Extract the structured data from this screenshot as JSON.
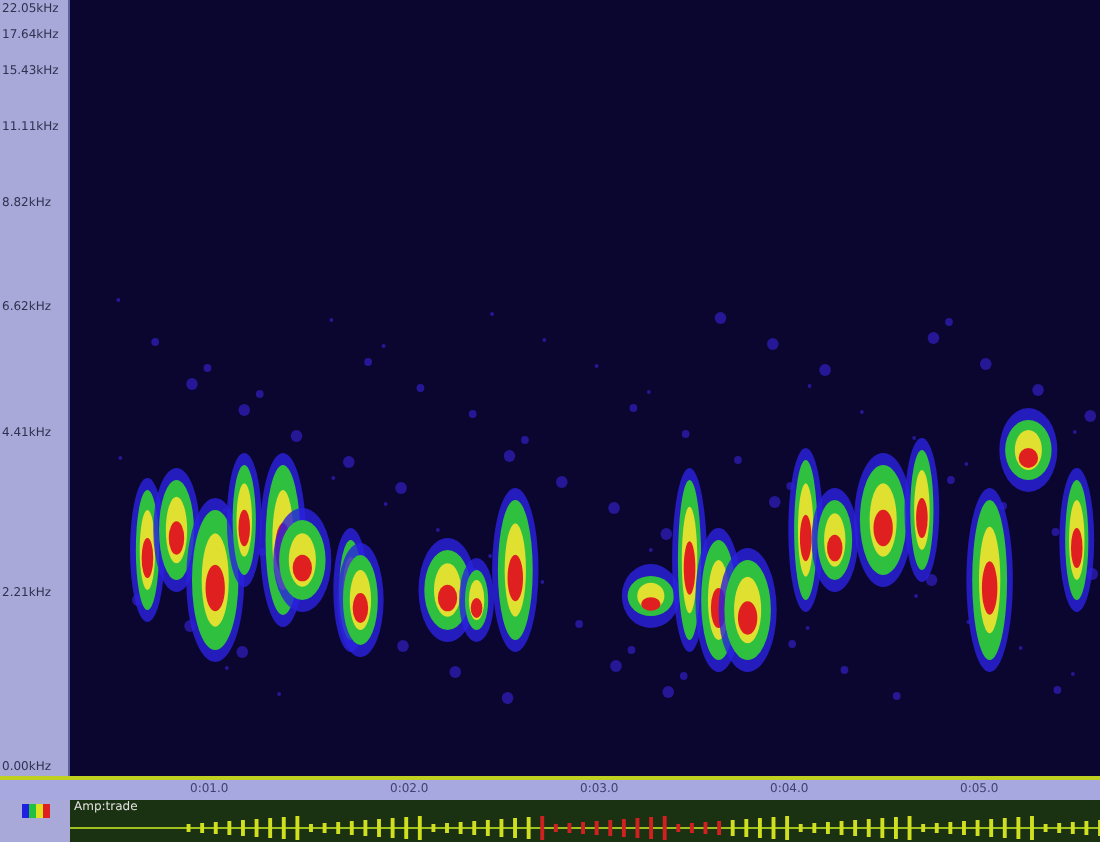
{
  "frequency_axis": {
    "labels": [
      "22.05kHz",
      "17.64kHz",
      "15.43kHz",
      "11.11kHz",
      "8.82kHz",
      "6.62kHz",
      "4.41kHz",
      "2.21kHz",
      "0.00kHz"
    ]
  },
  "time_axis": {
    "labels": [
      "0:01.0",
      "0:02.0",
      "0:03.0",
      "0:04.0",
      "0:05.0"
    ]
  },
  "waveform": {
    "title": "Amp:trade"
  }
}
